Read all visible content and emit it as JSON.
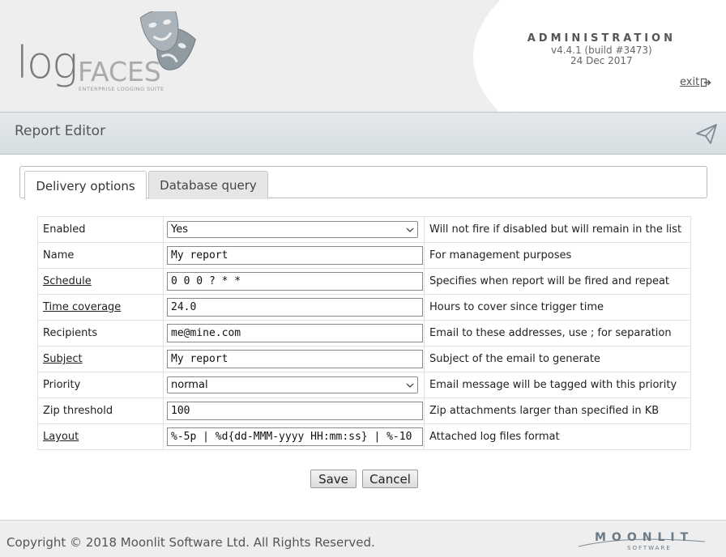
{
  "header": {
    "logo_log": "log",
    "logo_faces": "FACES",
    "logo_tagline": "ENTERPRISE LOGGING SUITE",
    "admin_title": "ADMINISTRATION",
    "version": "v4.4.1 (build #3473)",
    "date": "24 Dec 2017",
    "exit_label": "exit"
  },
  "titlebar": {
    "title": "Report Editor",
    "icon": "send-icon"
  },
  "tabs": [
    {
      "label": "Delivery options",
      "active": true
    },
    {
      "label": "Database query",
      "active": false
    }
  ],
  "form": {
    "rows": [
      {
        "label": "Enabled",
        "value": "Yes",
        "hint": "Will not fire if disabled but will remain in the list"
      },
      {
        "label": "Name",
        "value": "My report",
        "hint": "For management purposes"
      },
      {
        "label": "Schedule",
        "value": "0 0 0 ? * *",
        "hint": "Specifies when report will be fired and repeat"
      },
      {
        "label": "Time coverage",
        "value": "24.0",
        "hint": "Hours to cover since trigger time"
      },
      {
        "label": "Recipients",
        "value": "me@mine.com",
        "hint": "Email to these addresses, use ; for separation"
      },
      {
        "label": "Subject",
        "value": "My report",
        "hint": "Subject of the email to generate"
      },
      {
        "label": "Priority",
        "value": "normal",
        "hint": "Email message will be tagged with this priority"
      },
      {
        "label": "Zip threshold",
        "value": "100",
        "hint": "Zip attachments larger than specified in KB"
      },
      {
        "label": "Layout",
        "value": "%-5p | %d{dd-MMM-yyyy HH:mm:ss} | %-10",
        "hint": "Attached log files format"
      }
    ]
  },
  "buttons": {
    "save": "Save",
    "cancel": "Cancel"
  },
  "footer": {
    "copyright": "Copyright © 2018 Moonlit Software Ltd. All Rights Reserved.",
    "brand": "MOONLIT",
    "brand_sub": "SOFTWARE"
  },
  "colors": {
    "header_bg": "#eeeeee",
    "titlebar_bg": "#dde3e6",
    "footer_bg": "#eeeeee",
    "text": "#222222"
  }
}
